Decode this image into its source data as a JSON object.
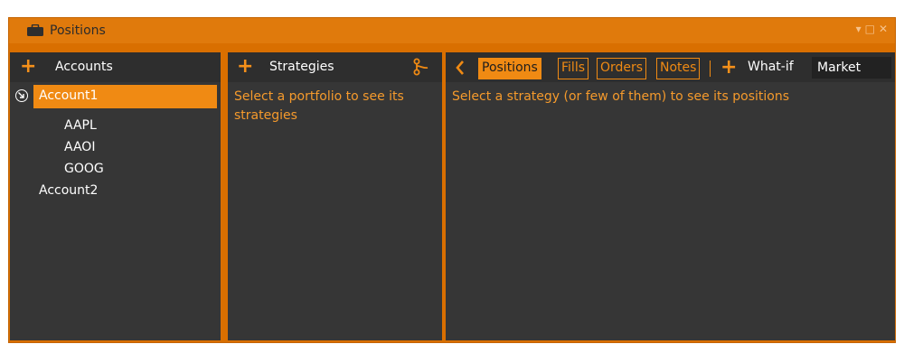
{
  "window": {
    "title": "Positions",
    "title_icon": "briefcase-icon",
    "controls": [
      "▾",
      "□",
      "✕"
    ]
  },
  "accounts_pane": {
    "add_icon": "plus-icon",
    "header": "Accounts",
    "tree": [
      {
        "label": "Account1",
        "selected": true,
        "children": [
          "AAPL",
          "AAOI",
          "GOOG"
        ]
      },
      {
        "label": "Account2",
        "selected": false,
        "children": []
      }
    ]
  },
  "strategies_pane": {
    "add_icon": "plus-icon",
    "header": "Strategies",
    "branch_icon": "branch-icon",
    "hint": "Select a portfolio to see its strategies"
  },
  "positions_pane": {
    "back_icon": "chevron-left-icon",
    "tabs": [
      {
        "label": "Positions",
        "active": true
      },
      {
        "label": "Fills",
        "active": false
      },
      {
        "label": "Orders",
        "active": false
      },
      {
        "label": "Notes",
        "active": false
      }
    ],
    "whatif_label": "What-if",
    "whatif_value": "Market",
    "hint": "Select a strategy (or few of them) to see its positions"
  },
  "colors": {
    "accent": "#f08a13",
    "frame": "#d96f00",
    "panel": "#363636",
    "header": "#2e2e2e"
  }
}
